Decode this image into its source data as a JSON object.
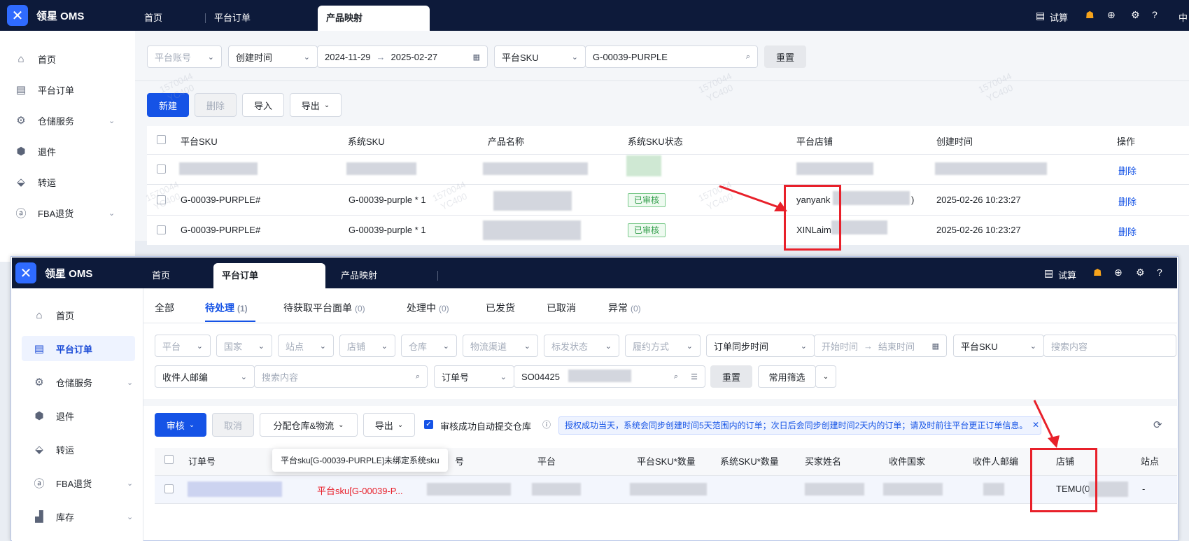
{
  "top": {
    "brand": "领星 OMS",
    "tabs": [
      "首页",
      "平台订单",
      "产品映射"
    ],
    "active_tab": "产品映射",
    "right": {
      "calc": "试算",
      "lang": "中"
    }
  },
  "sidebar_top": [
    "首页",
    "平台订单",
    "仓储服务",
    "退件",
    "转运",
    "FBA退货"
  ],
  "filters_top": {
    "platform_account": "平台账号",
    "created_time": "创建时间",
    "date_start": "2024-11-29",
    "date_end": "2025-02-27",
    "sku_type": "平台SKU",
    "sku_value": "G-00039-PURPLE",
    "reset": "重置"
  },
  "toolbar_top": {
    "new": "新建",
    "delete": "删除",
    "import": "导入",
    "export": "导出"
  },
  "table_top": {
    "headers": [
      "平台SKU",
      "系统SKU",
      "产品名称",
      "系统SKU状态",
      "平台店铺",
      "创建时间",
      "操作"
    ],
    "rows": [
      {
        "platform_sku": "G-00039-PURPLE#",
        "system_sku": "G-00039-purple * 1",
        "status": "已审核",
        "shop": "yanyank",
        "shop_suffix": ")",
        "created": "2025-02-26 10:23:27",
        "action": "删除"
      },
      {
        "platform_sku": "G-00039-PURPLE#",
        "system_sku": "G-00039-purple * 1",
        "status": "已审核",
        "shop": "XINLaim",
        "shop_suffix": "",
        "created": "2025-02-26 10:23:27",
        "action": "删除"
      }
    ],
    "first_row_action": "删除"
  },
  "watermark": {
    "line1": "1570044",
    "line2": "YC400"
  },
  "second": {
    "brand": "领星 OMS",
    "tabs": [
      "首页",
      "平台订单",
      "产品映射"
    ],
    "active_tab": "平台订单",
    "right": {
      "calc": "试算"
    },
    "sidebar": [
      "首页",
      "平台订单",
      "仓储服务",
      "退件",
      "转运",
      "FBA退货",
      "库存"
    ],
    "status_tabs": [
      {
        "label": "全部",
        "count": ""
      },
      {
        "label": "待处理",
        "count": "(1)"
      },
      {
        "label": "待获取平台面单",
        "count": "(0)"
      },
      {
        "label": "处理中",
        "count": "(0)"
      },
      {
        "label": "已发货",
        "count": ""
      },
      {
        "label": "已取消",
        "count": ""
      },
      {
        "label": "异常",
        "count": "(0)"
      }
    ],
    "filters": {
      "row1": [
        "平台",
        "国家",
        "站点",
        "店铺",
        "仓库",
        "物流渠道",
        "标发状态",
        "履约方式"
      ],
      "sync_time": "订单同步时间",
      "start_time": "开始时间",
      "end_time": "结束时间",
      "sku_type": "平台SKU",
      "search_ph": "搜索内容",
      "email": "收件人邮编",
      "order_no": "订单号",
      "order_value": "SO04425",
      "reset": "重置",
      "common": "常用筛选"
    },
    "toolbar": {
      "audit": "审核",
      "cancel": "取消",
      "assign": "分配仓库&物流",
      "export": "导出",
      "auto_submit": "审核成功自动提交仓库",
      "notice": "授权成功当天，系统会同步创建时间5天范围内的订单；次日后会同步创建时间2天内的订单；请及时前往平台更正订单信息。"
    },
    "table_headers": [
      "订单号",
      "号",
      "平台",
      "平台SKU*数量",
      "系统SKU*数量",
      "买家姓名",
      "收件国家",
      "收件人邮编",
      "店铺",
      "站点"
    ],
    "tooltip": "平台sku[G-00039-PURPLE]未绑定系统sku",
    "row": {
      "error": "平台sku[G-00039-P...",
      "shop": "TEMU(0",
      "site": "-"
    }
  }
}
